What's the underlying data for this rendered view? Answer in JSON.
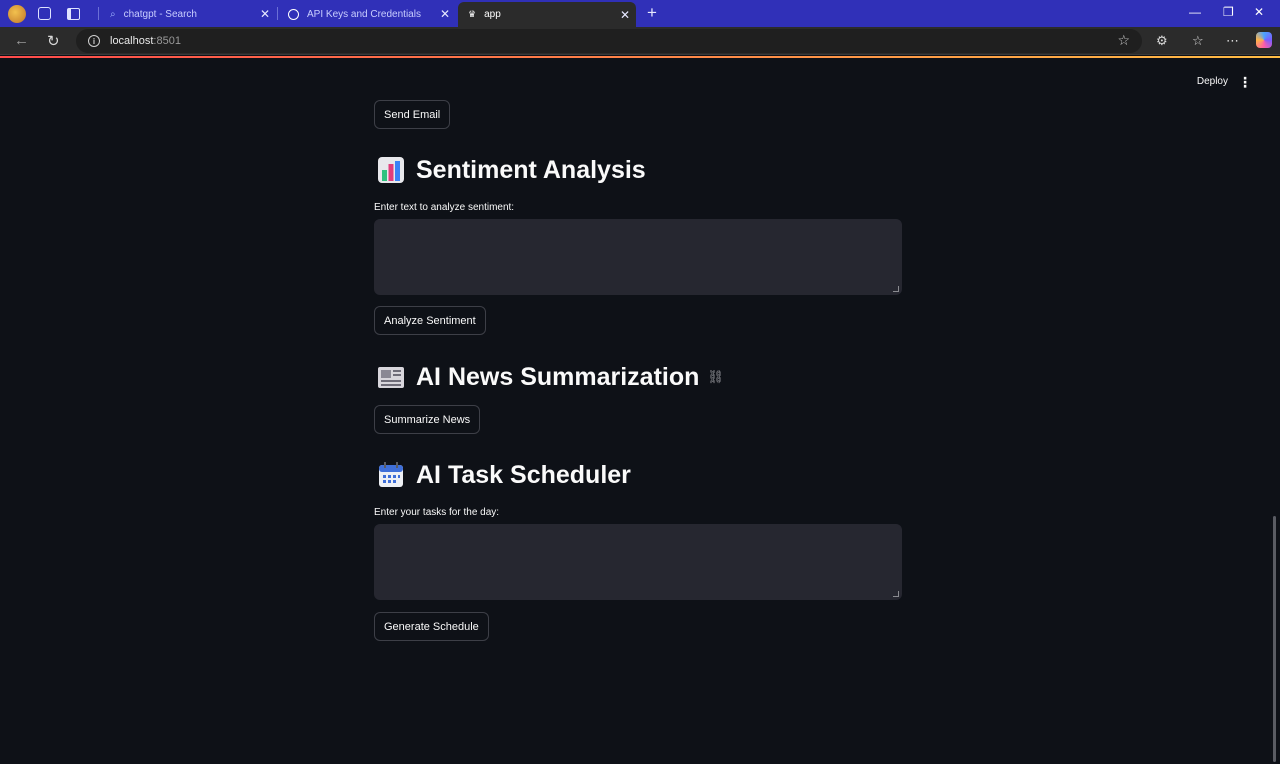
{
  "browser": {
    "tabs": [
      {
        "label": "chatgpt - Search",
        "active": false
      },
      {
        "label": "API Keys and Credentials",
        "active": false
      },
      {
        "label": "app",
        "active": true
      }
    ],
    "new_tab_icon": "plus-icon",
    "url_host": "localhost",
    "url_port": ":8501",
    "window_controls": [
      "minimize-icon",
      "restore-icon",
      "close-icon"
    ]
  },
  "app": {
    "toolbar": {
      "deploy_label": "Deploy",
      "menu_icon": "kebab-menu-icon"
    },
    "send_email_label": "Send Email",
    "sentiment": {
      "title": "Sentiment Analysis",
      "icon": "bar-chart-emoji",
      "input_label": "Enter text to analyze sentiment:",
      "input_value": "",
      "button_label": "Analyze Sentiment"
    },
    "news": {
      "title": "AI News Summarization",
      "icon": "newspaper-emoji",
      "button_label": "Summarize News"
    },
    "scheduler": {
      "title": "AI Task Scheduler",
      "icon": "calendar-emoji",
      "input_label": "Enter your tasks for the day:",
      "input_value": "",
      "button_label": "Generate Schedule"
    }
  },
  "colors": {
    "tabbar": "#3030b8",
    "app_background": "#0e1117",
    "textarea_background": "#262730",
    "accent_red": "#ff4b4b"
  }
}
